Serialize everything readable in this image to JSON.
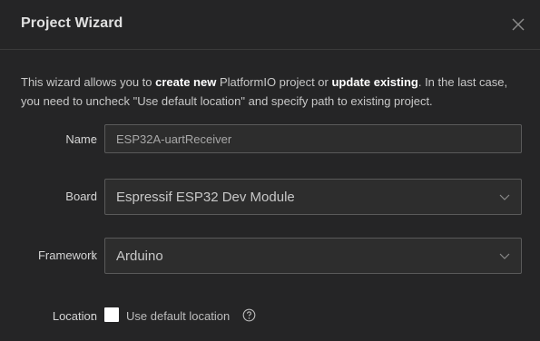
{
  "dialog": {
    "title": "Project Wizard",
    "close_icon": "close-icon"
  },
  "description": {
    "part1": "This wizard allows you to ",
    "bold1": "create new",
    "part2": " PlatformIO project or ",
    "bold2": "update existing",
    "part3": ". In the last case, you need to uncheck \"Use default location\" and specify path to existing project."
  },
  "form": {
    "name": {
      "label": "Name",
      "value": "ESP32A-uartReceiver"
    },
    "board": {
      "label": "Board",
      "selected": "Espressif ESP32 Dev Module",
      "icon": "chevron-down-icon"
    },
    "framework": {
      "label": "Framework",
      "selected": "Arduino",
      "icon": "chevron-down-icon"
    },
    "location": {
      "label": "Location",
      "checkbox_label": "Use default location",
      "checked": false,
      "help_icon": "help-circle-icon"
    },
    "colon": ":"
  },
  "colors": {
    "background": "#252526",
    "input_background": "#2d2d2d",
    "border": "#5a5a5a",
    "text": "#cccccc",
    "title": "#e0e0e0"
  }
}
